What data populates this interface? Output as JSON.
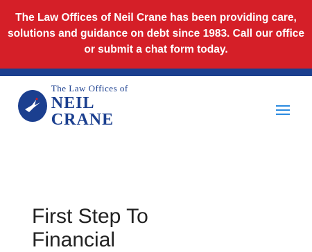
{
  "banner": {
    "lines": [
      "The Law Offices of Neil Crane has been providing care,",
      "solutions and guidance on debt since 1983.  Call our office",
      "or submit a chat form today."
    ]
  },
  "header": {
    "logo_small": "The Law Offices of",
    "logo_big": "NEIL CRANE",
    "menu_icon": "hamburger-icon"
  },
  "main": {
    "heading_line1": "First Step To",
    "heading_line2": "Financial"
  },
  "colors": {
    "banner": "#d51f28",
    "brand_blue": "#1b3f8f",
    "menu_blue": "#2b8be0"
  }
}
